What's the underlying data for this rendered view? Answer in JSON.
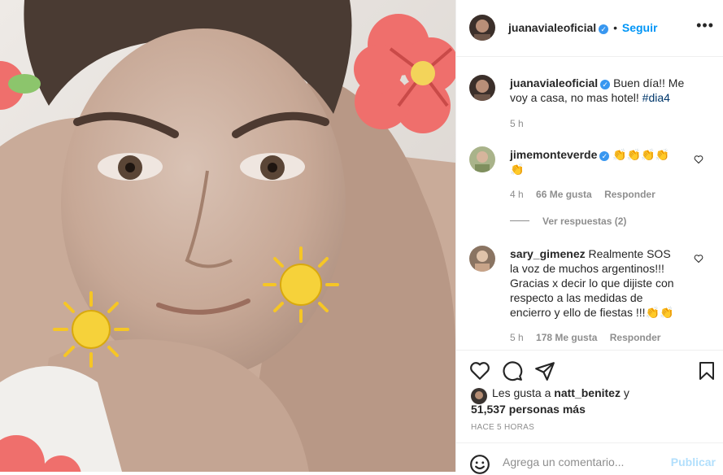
{
  "post": {
    "author": "juanavialeoficial",
    "follow_label": "Seguir",
    "separator": "•",
    "caption_text": "Buen día!! Me voy a casa, no mas hotel!",
    "caption_hashtag": "#dia4",
    "caption_time": "5 h"
  },
  "comments": [
    {
      "user": "jimemonteverde",
      "text": "👏👏👏👏👏",
      "time": "4 h",
      "likes": "66 Me gusta",
      "reply_label": "Responder",
      "view_replies": "Ver respuestas (2)"
    },
    {
      "user": "sary_gimenez",
      "text": "Realmente SOS la voz de muchos argentinos!!! Gracias x decir lo que dijiste con respecto a las medidas de encierro y ello de fiestas !!!👏👏",
      "time": "5 h",
      "likes": "178 Me gusta",
      "reply_label": "Responder"
    }
  ],
  "likes": {
    "prefix": "Les gusta a",
    "user": "natt_benitez",
    "conjunction": "y",
    "count": "51,537 personas más"
  },
  "time_ago": "HACE 5 HORAS",
  "comment_box": {
    "placeholder": "Agrega un comentario...",
    "publish_label": "Publicar"
  },
  "icons": {
    "menu": "more-horizontal-icon",
    "like": "heart-icon",
    "comment": "comment-bubble-icon",
    "share": "send-paper-plane-icon",
    "save": "bookmark-icon",
    "emoji": "emoji-smiley-icon",
    "verified": "verified-badge-icon"
  },
  "colors": {
    "link": "#0095f6",
    "verified": "#3897f0",
    "muted": "#8e8e8e",
    "border": "#efefef",
    "publish_disabled": "#b2dffc"
  }
}
